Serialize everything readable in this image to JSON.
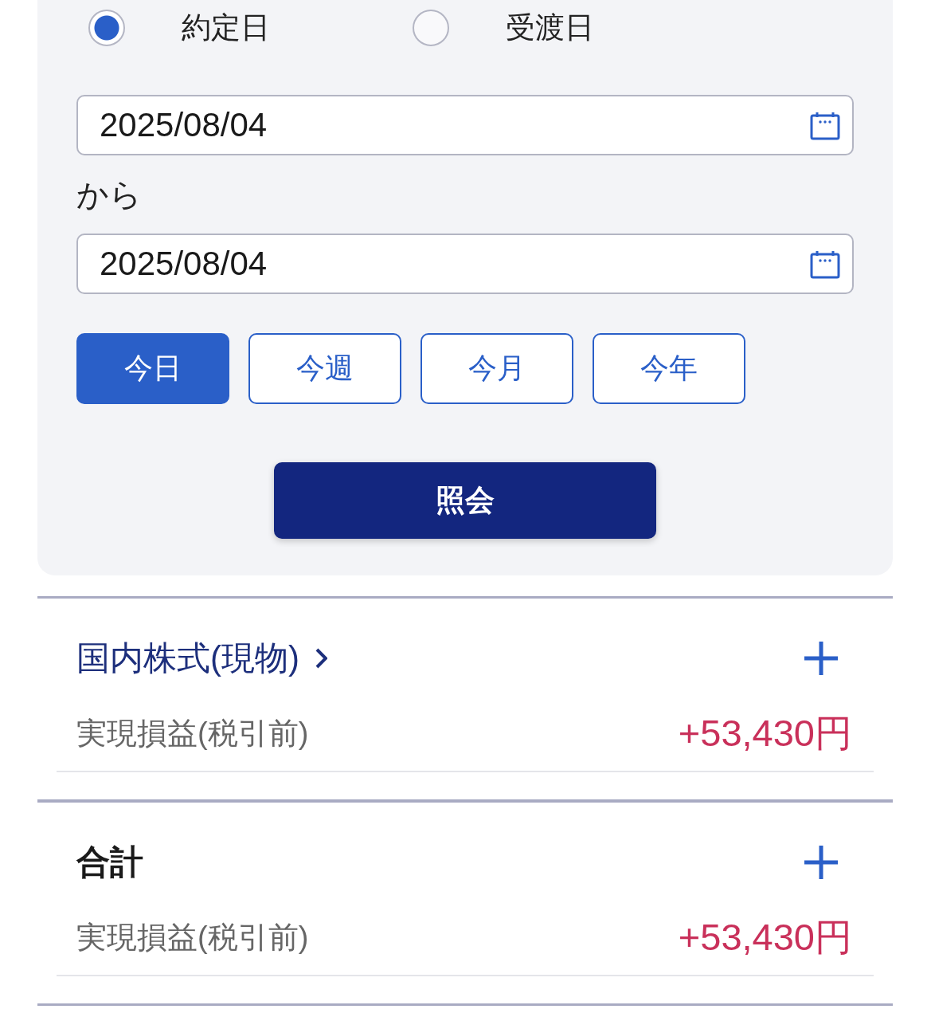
{
  "filter_panel": {
    "date_basis": [
      {
        "label": "約定日",
        "selected": true
      },
      {
        "label": "受渡日",
        "selected": false
      }
    ],
    "date_from": {
      "value": "2025/08/04"
    },
    "range_label": "から",
    "date_to": {
      "value": "2025/08/04"
    },
    "period_buttons": [
      {
        "label": "今日",
        "selected": true
      },
      {
        "label": "今週",
        "selected": false
      },
      {
        "label": "今月",
        "selected": false
      },
      {
        "label": "今年",
        "selected": false
      }
    ],
    "submit_button": {
      "label": "照会"
    }
  },
  "sections": [
    {
      "kind": "link",
      "title": "国内株式(現物)",
      "expanded": false,
      "rows": [
        {
          "label": "実現損益(税引前)",
          "value": "+53,430円"
        }
      ]
    },
    {
      "kind": "total",
      "title": "合計",
      "expanded": false,
      "rows": [
        {
          "label": "実現損益(税引前)",
          "value": "+53,430円"
        }
      ]
    }
  ]
}
